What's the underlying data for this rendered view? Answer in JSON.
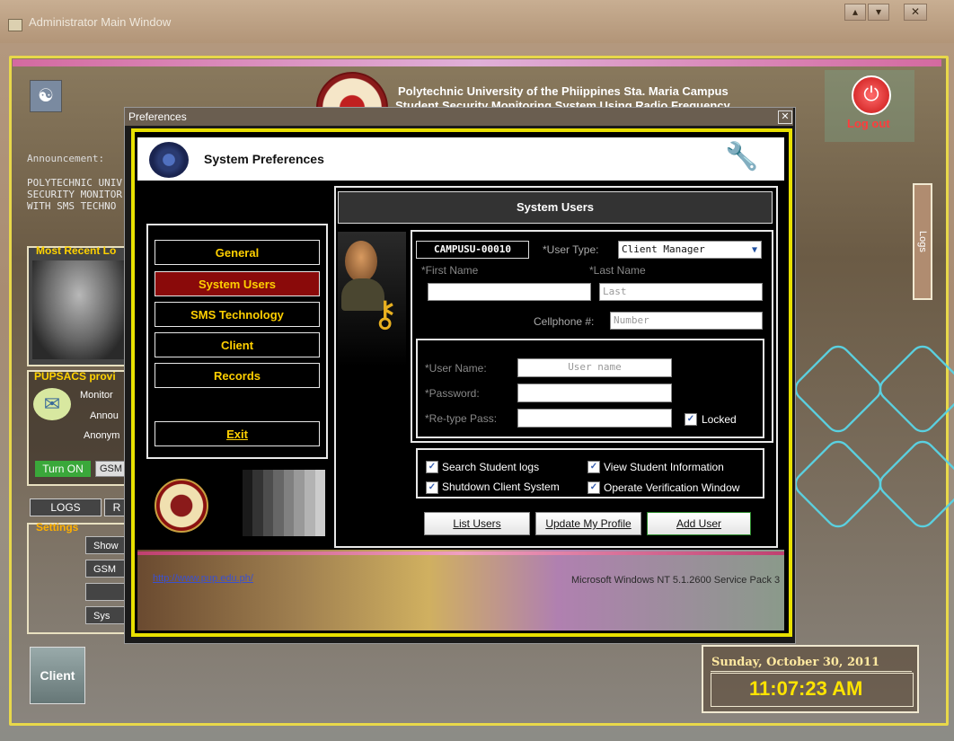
{
  "main_window": {
    "title": "Administrator Main Window",
    "controls": [
      "▴",
      "▾",
      "✕"
    ],
    "university_line1": "Polytechnic University of the Phiippines Sta. Maria Campus",
    "university_line2": "Student Security Monitoring System Using Radio Frequency",
    "logout_label": "Log out",
    "announcement_label": "Announcement:",
    "announcement_text": "POLYTECHNIC UNIV\nSECURITY MONITOR\nWITH SMS TECHNO",
    "recent_title": "Most Recent Lo",
    "pupsacs_title": "PUPSACS provi",
    "pupsacs_lines": [
      "Monitor",
      "Annou",
      "Anonym"
    ],
    "turn_on_label": "Turn ON",
    "gsm_label": "GSM",
    "logs_button": "LOGS",
    "r_button": "R",
    "settings_title": "Settings",
    "settings_buttons": [
      "Show",
      "GSM M",
      "",
      "Sys"
    ],
    "logs_side_label": "Logs",
    "client_tile_label": "Client",
    "date_text": "Sunday, October 30, 2011",
    "time_text": "11:07:23 AM"
  },
  "preferences": {
    "window_title": "Preferences",
    "close_label": "✕",
    "header_title": "System Preferences",
    "nav": [
      "General",
      "System Users",
      "SMS Technology",
      "Client",
      "Records",
      "Exit"
    ],
    "active_nav": "System Users",
    "content_title": "System Users",
    "form": {
      "user_id": "CAMPUSU-00010",
      "user_type_label": "*User Type:",
      "user_type_value": "Client Manager",
      "first_name_label": "*First Name",
      "first_name_value": "",
      "last_name_label": "*Last Name",
      "last_name_placeholder": "Last",
      "cellphone_label": "Cellphone #:",
      "cellphone_placeholder": "Number",
      "username_label": "*User Name:",
      "username_placeholder": "User name",
      "password_label": "*Password:",
      "retype_label": "*Re-type Pass:",
      "locked_label": "Locked",
      "locked_checked": true
    },
    "permissions": [
      {
        "label": "Search Student logs",
        "checked": true
      },
      {
        "label": "View Student Information",
        "checked": true
      },
      {
        "label": "Shutdown Client System",
        "checked": true
      },
      {
        "label": "Operate Verification Window",
        "checked": true
      }
    ],
    "buttons": {
      "list_users": "List Users",
      "update_profile": "Update My Profile",
      "add_user": "Add User"
    },
    "footer_link": "http://www.pup.edu.ph/",
    "footer_os": "Microsoft Windows NT 5.1.2600 Service Pack 3"
  },
  "colors": {
    "accent_yellow": "#e8e000",
    "nav_active": "#8a0a0a",
    "nav_text": "#ffd000",
    "time_color": "#ffe400"
  }
}
